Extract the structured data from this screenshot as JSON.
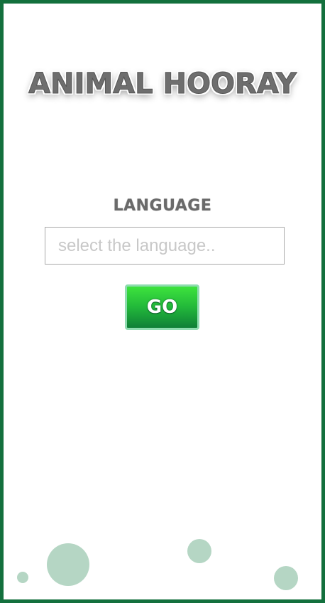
{
  "app": {
    "title": "ANIMAL HOORAY"
  },
  "language": {
    "label": "LANGUAGE",
    "input_value": "",
    "placeholder": "select the language.."
  },
  "actions": {
    "go_label": "GO"
  },
  "colors": {
    "border": "#13703d",
    "button_top": "#3de33d",
    "button_bottom": "#0f7f37",
    "bubble": "#b5d6c4",
    "title": "#6e6e6e"
  }
}
